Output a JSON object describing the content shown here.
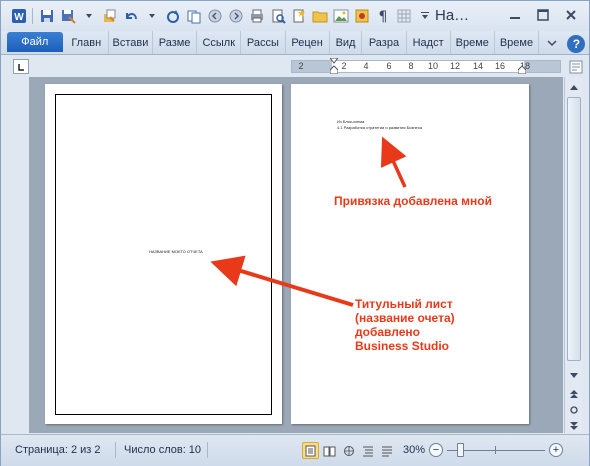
{
  "window": {
    "title": "На…"
  },
  "ribbon": {
    "file_tab": "Файл",
    "tabs": [
      "Главн",
      "Встави",
      "Разме",
      "Ссылк",
      "Рассы",
      "Рецен",
      "Вид",
      "Разра",
      "Надст",
      "Време",
      "Време"
    ]
  },
  "ruler": {
    "numbers": [
      "2",
      "2",
      "4",
      "6",
      "8",
      "10",
      "12",
      "14",
      "16",
      "18"
    ]
  },
  "document": {
    "page1_title_text": "НАЗВАНИЕ МОЕГО ОТЧЕТА",
    "page2_line1": "Из Блок-схема",
    "page2_line2": "4.1 Разработка стратегии и развития Бизнеса"
  },
  "status": {
    "page": "Страница: 2 из 2",
    "words": "Число слов: 10",
    "zoom_percent": "30%",
    "zoom_level": 30
  },
  "annotations": {
    "binding_note": "Привязка добавлена мной",
    "title_note": [
      "Титульный лист",
      "(название очета)",
      "добавлено",
      "Business Studio"
    ]
  },
  "colors": {
    "annotation": "#e83a1a",
    "file_tab": "#2a6cc6"
  }
}
